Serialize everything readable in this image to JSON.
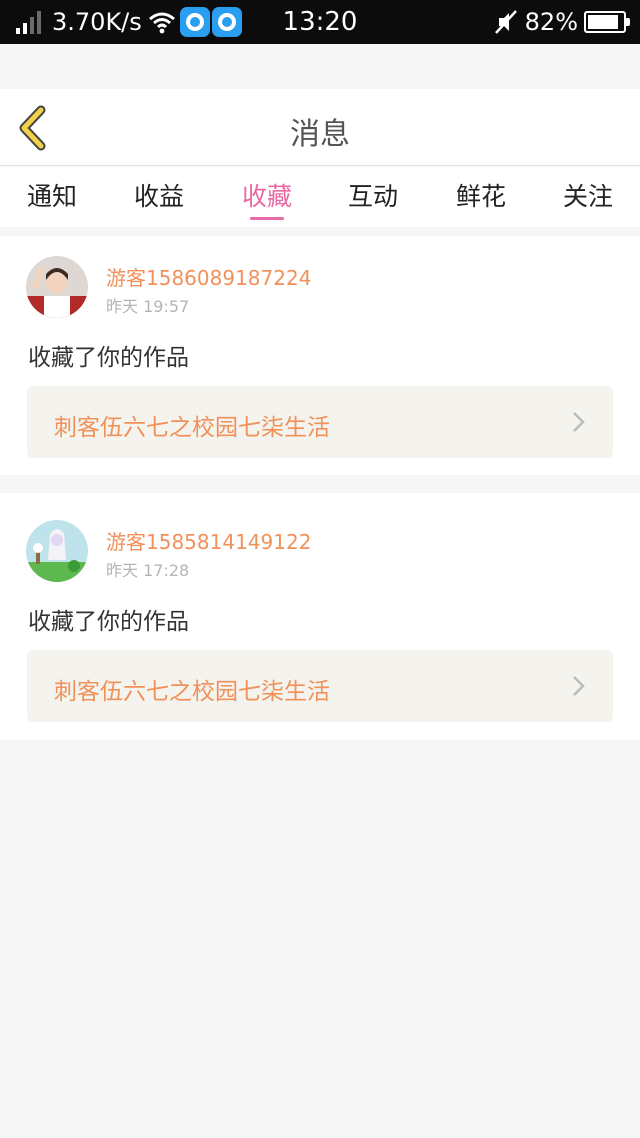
{
  "status_bar": {
    "net_speed": "3.70K/s",
    "time": "13:20",
    "battery": "82%"
  },
  "header": {
    "title": "消息",
    "back_icon": "back-arrow-icon",
    "accent_color": "#f0d24a"
  },
  "tabs": [
    {
      "label": "通知",
      "active": false
    },
    {
      "label": "收益",
      "active": false
    },
    {
      "label": "收藏",
      "active": true
    },
    {
      "label": "互动",
      "active": false
    },
    {
      "label": "鲜花",
      "active": false
    },
    {
      "label": "关注",
      "active": false
    }
  ],
  "colors": {
    "active_tab": "#e86aa6",
    "username": "#f0915a",
    "work_title": "#f0915a"
  },
  "messages": [
    {
      "username": "游客1586089187224",
      "time": "昨天 19:57",
      "action": "收藏了你的作品",
      "work_title": "刺客伍六七之校园七柒生活"
    },
    {
      "username": "游客1585814149122",
      "time": "昨天 17:28",
      "action": "收藏了你的作品",
      "work_title": "刺客伍六七之校园七柒生活"
    }
  ]
}
